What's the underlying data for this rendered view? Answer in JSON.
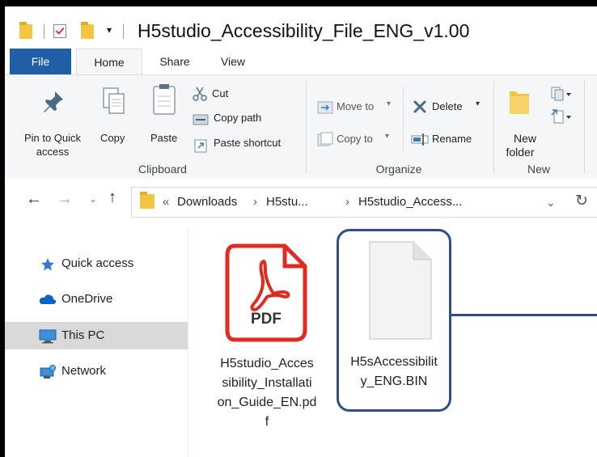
{
  "window": {
    "title": "H5studio_Accessibility_File_ENG_v1.00"
  },
  "tabs": [
    {
      "label": "File"
    },
    {
      "label": "Home"
    },
    {
      "label": "Share"
    },
    {
      "label": "View"
    }
  ],
  "ribbon": {
    "clipboard": {
      "pin_label_1": "Pin to Quick",
      "pin_label_2": "access",
      "copy_label": "Copy",
      "paste_label": "Paste",
      "cut_label": "Cut",
      "copy_path_label": "Copy path",
      "paste_shortcut_label": "Paste shortcut",
      "group_label": "Clipboard"
    },
    "organize": {
      "move_to_label": "Move to",
      "copy_to_label": "Copy to",
      "delete_label": "Delete",
      "rename_label": "Rename",
      "group_label": "Organize"
    },
    "new": {
      "new_folder_label_1": "New",
      "new_folder_label_2": "folder",
      "group_label": "New"
    }
  },
  "address": {
    "chevron": "«",
    "crumbs": [
      "Downloads",
      "H5stu...",
      "H5studio_Access..."
    ],
    "separator": "›"
  },
  "sidebar": {
    "items": [
      {
        "label": "Quick access"
      },
      {
        "label": "OneDrive"
      },
      {
        "label": "This PC"
      },
      {
        "label": "Network"
      }
    ]
  },
  "files": [
    {
      "icon_text": "PDF",
      "name_lines": [
        "H5studio_Acces",
        "sibility_Installati",
        "on_Guide_EN.pd",
        "f"
      ]
    },
    {
      "name_lines": [
        "H5sAccessibilit",
        "y_ENG.BIN"
      ]
    }
  ],
  "colors": {
    "file_tab": "#1f5fa6",
    "highlight": "#2f4f8a",
    "pdf_red": "#e02a22",
    "folder": "#f4c542",
    "selected_nav": "#d9d9d9"
  }
}
